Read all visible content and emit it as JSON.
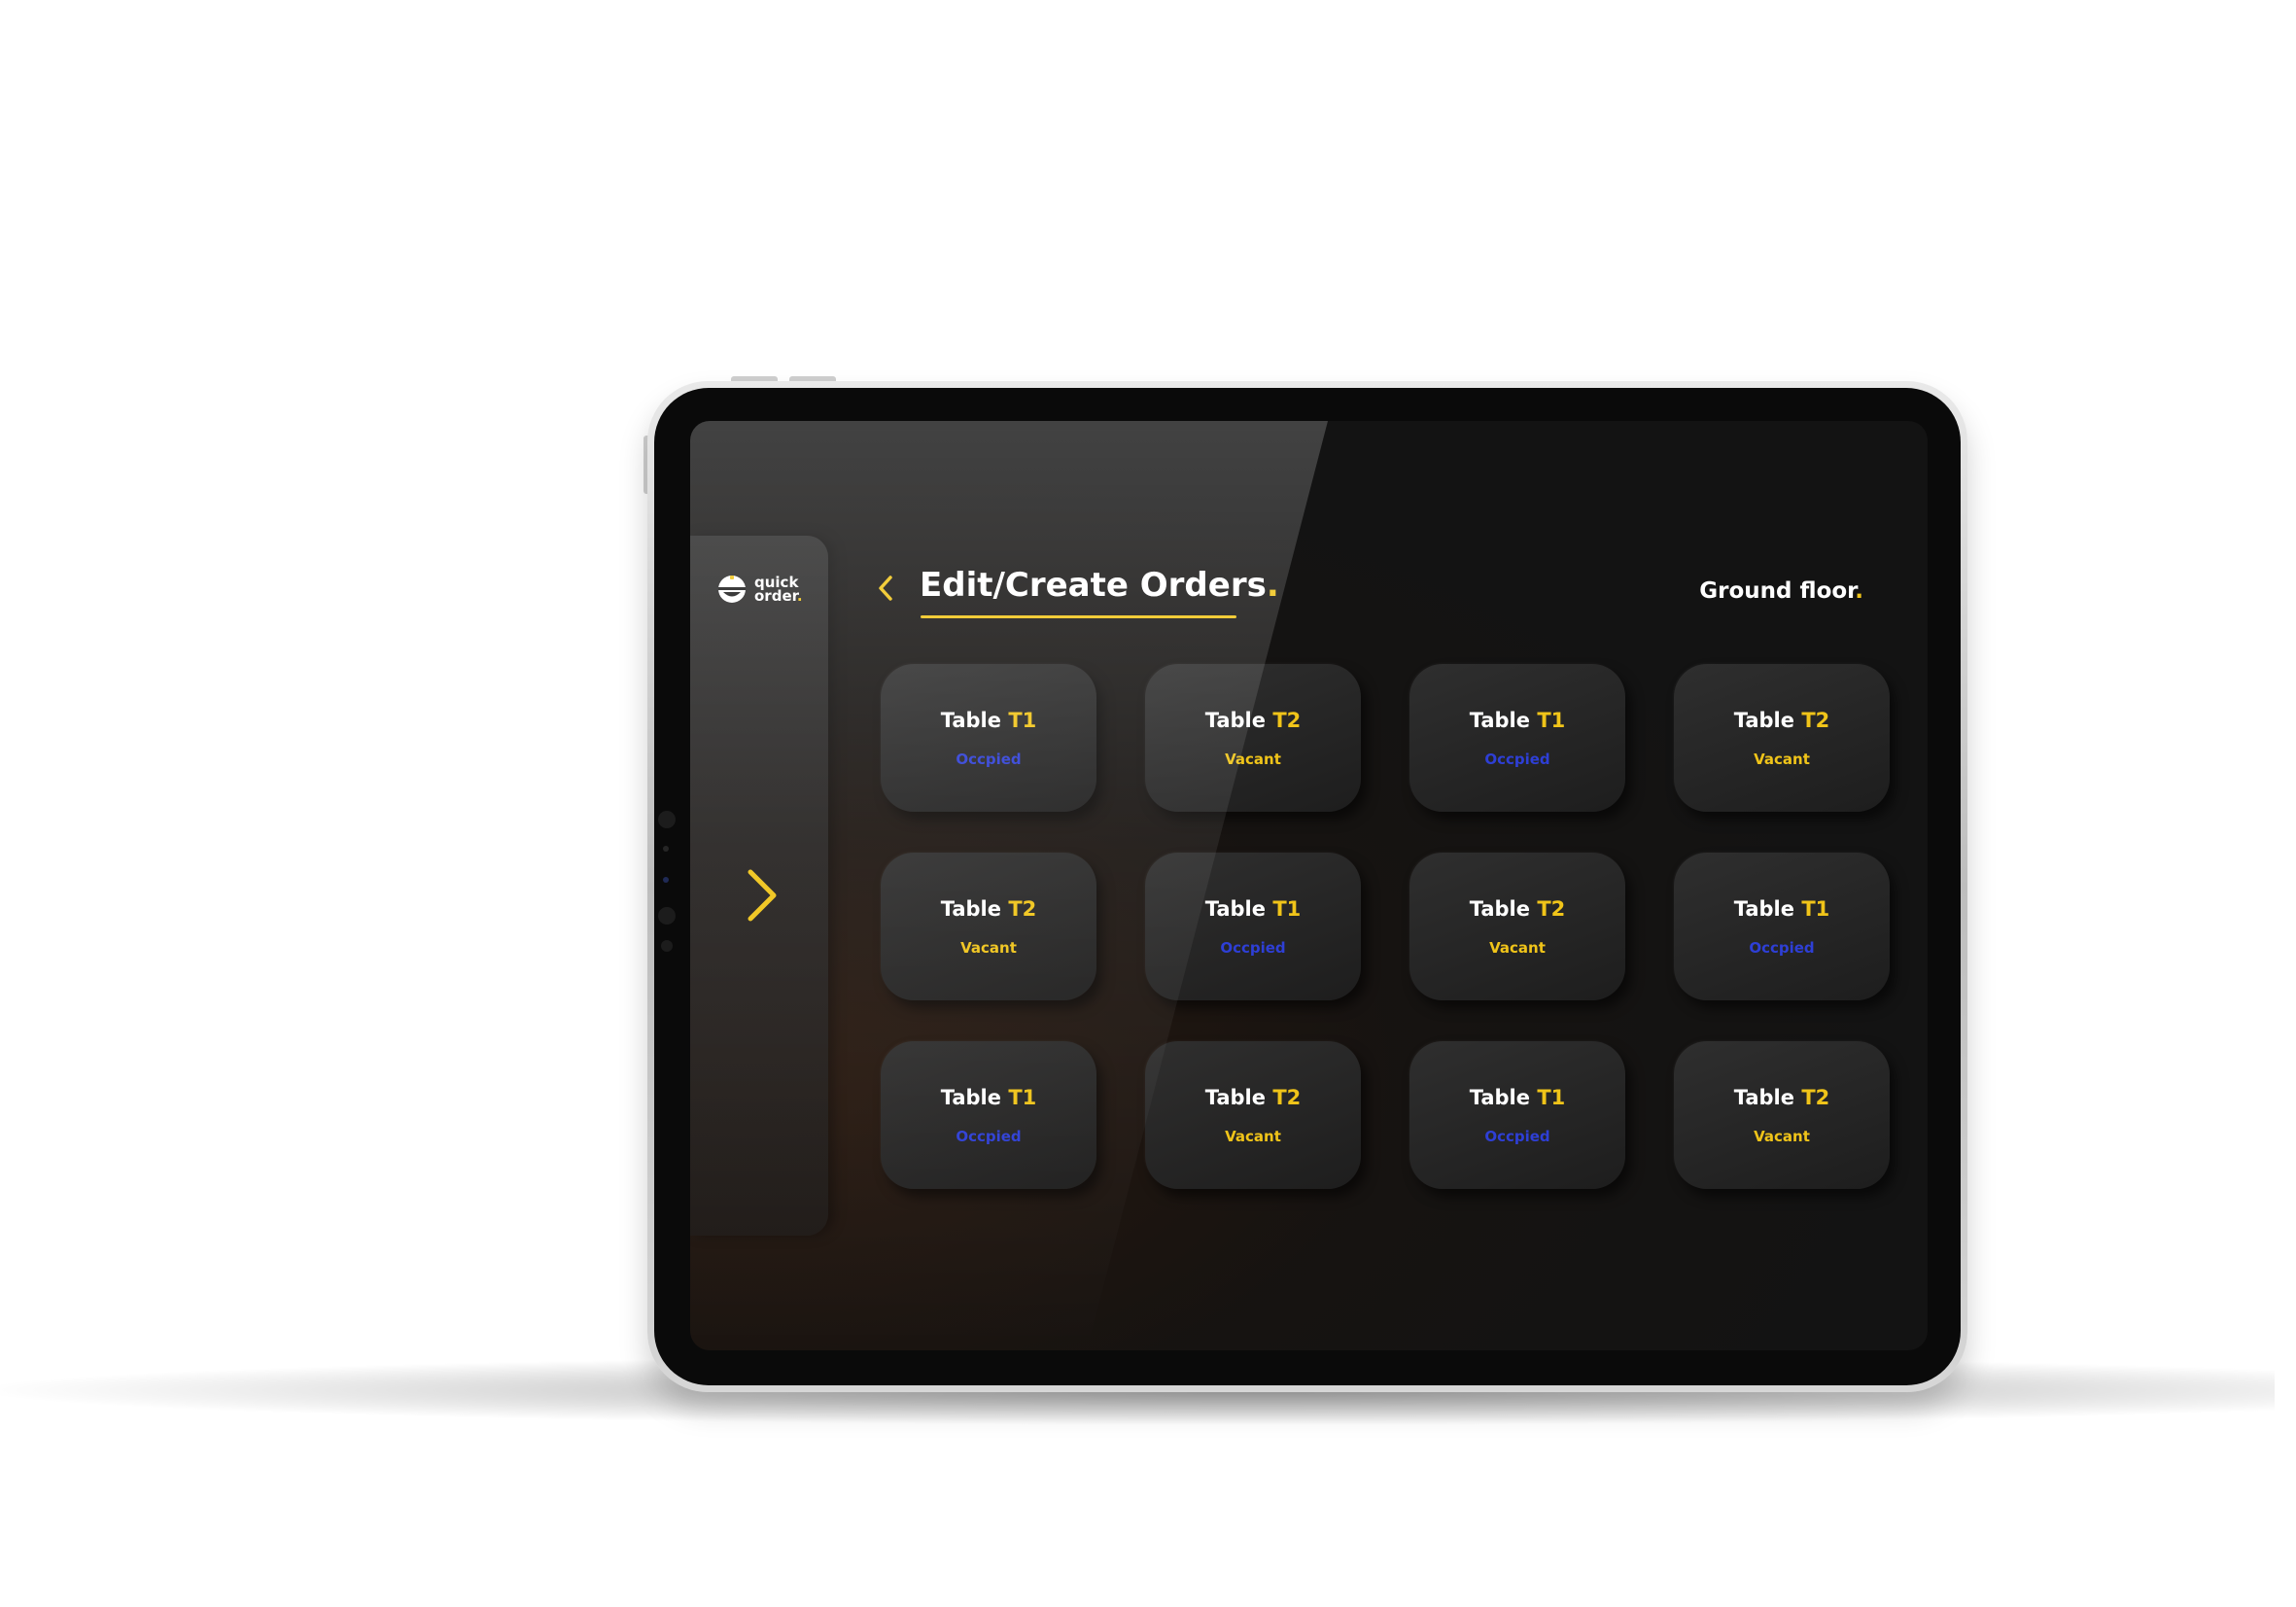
{
  "app": {
    "logo_line1": "quick",
    "logo_line2": "order",
    "logo_dot": ".",
    "brand_color": "#f0c419"
  },
  "header": {
    "back_icon": "chevron-left-icon",
    "title": "Edit/Create Orders",
    "title_dot": ".",
    "floor": "Ground floor",
    "floor_dot": "."
  },
  "sidebar": {
    "next_icon": "chevron-right-icon"
  },
  "tables": [
    {
      "prefix": "Table ",
      "code": "T1",
      "status": "Occpied",
      "state": "occupied"
    },
    {
      "prefix": "Table ",
      "code": "T2",
      "status": "Vacant",
      "state": "vacant"
    },
    {
      "prefix": "Table ",
      "code": "T1",
      "status": "Occpied",
      "state": "occupied"
    },
    {
      "prefix": "Table ",
      "code": "T2",
      "status": "Vacant",
      "state": "vacant"
    },
    {
      "prefix": "Table ",
      "code": "T2",
      "status": "Vacant",
      "state": "vacant"
    },
    {
      "prefix": "Table ",
      "code": "T1",
      "status": "Occpied",
      "state": "occupied"
    },
    {
      "prefix": "Table ",
      "code": "T2",
      "status": "Vacant",
      "state": "vacant"
    },
    {
      "prefix": "Table ",
      "code": "T1",
      "status": "Occpied",
      "state": "occupied"
    },
    {
      "prefix": "Table ",
      "code": "T1",
      "status": "Occpied",
      "state": "occupied"
    },
    {
      "prefix": "Table ",
      "code": "T2",
      "status": "Vacant",
      "state": "vacant"
    },
    {
      "prefix": "Table ",
      "code": "T1",
      "status": "Occpied",
      "state": "occupied"
    },
    {
      "prefix": "Table ",
      "code": "T2",
      "status": "Vacant",
      "state": "vacant"
    }
  ],
  "colors": {
    "occupied": "#2e3fd6",
    "vacant": "#f0c419",
    "screen_bg": "#131313"
  }
}
